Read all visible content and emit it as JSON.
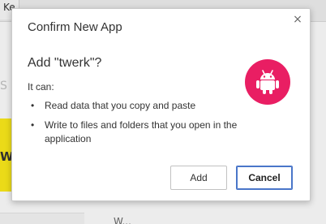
{
  "background": {
    "tab_label": "Ke",
    "partial_text_s": "S",
    "partial_text_w": "W",
    "bottom_text": "W..."
  },
  "dialog": {
    "title": "Confirm New App",
    "close_glyph": "×",
    "heading": "Add \"twerk\"?",
    "it_can": "It can:",
    "permissions": [
      "Read data that you copy and paste",
      "Write to files and folders that you open in the application"
    ],
    "bullet": "•",
    "icon": "android-icon",
    "icon_color": "#e91e63",
    "buttons": {
      "add": "Add",
      "cancel": "Cancel"
    }
  }
}
